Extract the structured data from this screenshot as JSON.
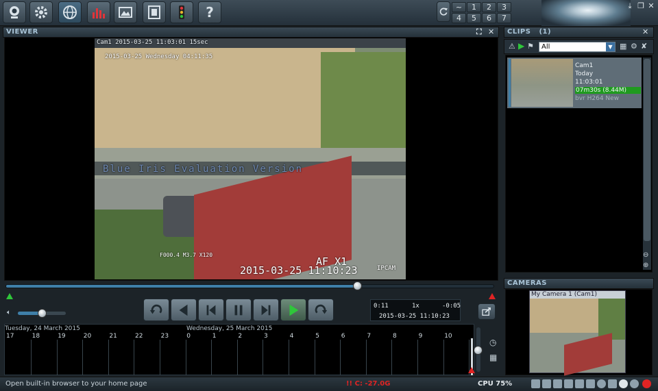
{
  "toolbar": {
    "buttons": [
      {
        "name": "webcam-icon"
      },
      {
        "name": "gear-icon"
      },
      {
        "name": "globe-icon"
      },
      {
        "name": "bar-chart-icon"
      },
      {
        "name": "picture-icon"
      },
      {
        "name": "film-icon"
      },
      {
        "name": "traffic-light-icon"
      },
      {
        "name": "help-icon"
      }
    ],
    "layout_numbers": [
      "~",
      "1",
      "2",
      "3",
      "4",
      "5",
      "6",
      "7"
    ]
  },
  "viewer": {
    "title": "VIEWER",
    "video_header": "Cam1  2015-03-25 11:03:01  15sec",
    "osd_top": "2015-03-25 Wednesday 04:11:35",
    "watermark": "Blue Iris Evaluation Version",
    "osd_bottom_left": "F000.4  M3.7 X120",
    "osd_af": "AF X1",
    "osd_datetime": "2015-03-25  11:10:23",
    "osd_brand": "IPCAM",
    "seek_fraction": 0.72
  },
  "playback": {
    "elapsed": "0:11",
    "speed": "1x",
    "remaining": "-0:05",
    "timestamp": "2015-03-25 11:10:23",
    "volume_fraction": 0.5
  },
  "timeline": {
    "day1_label": "Tuesday, 24 March 2015",
    "day2_label": "Wednesday, 25 March 2015",
    "hours": [
      "17",
      "18",
      "19",
      "20",
      "21",
      "22",
      "23",
      "0",
      "1",
      "2",
      "3",
      "4",
      "5",
      "6",
      "7",
      "8",
      "9",
      "10"
    ]
  },
  "clips": {
    "title": "CLIPS",
    "count": "(1)",
    "filter": "All",
    "items": [
      {
        "camera": "Cam1",
        "day": "Today",
        "time": "11:03:01",
        "duration": "07m30s (8.44M)",
        "format": "bvr H264 New"
      }
    ]
  },
  "cameras": {
    "title": "CAMERAS",
    "items": [
      {
        "label": "My Camera 1 (Cam1)"
      }
    ]
  },
  "status": {
    "message": "Open built-in browser to your home page",
    "temperature": "!! C: -27.0G",
    "cpu": "CPU 75%"
  },
  "colors": {
    "accent": "#3f7fa8",
    "panel_header_text": "#a8c3d6",
    "play_green": "#2fc63a",
    "duration_bar": "#1f9a1f",
    "alert_red": "#e02424"
  }
}
